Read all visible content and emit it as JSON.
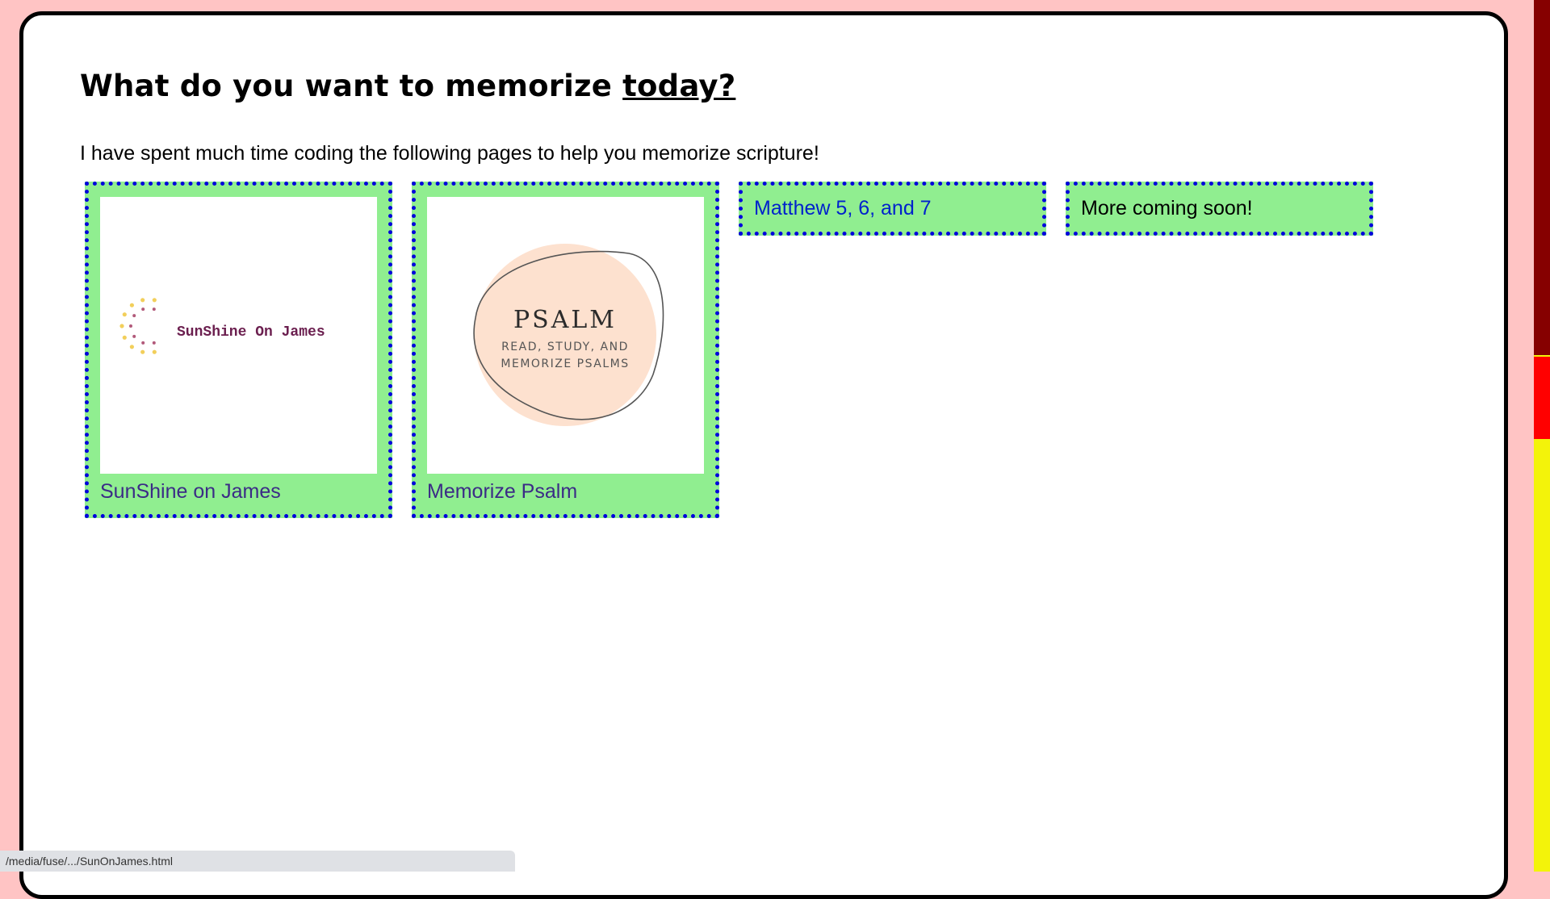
{
  "page": {
    "heading_prefix": "What do you want to memorize ",
    "heading_emphasis": "today?",
    "intro": "I have spent much time coding the following pages to help you memorize scripture!"
  },
  "tiles": [
    {
      "label": "SunShine on James",
      "image": {
        "logo_text": "SunShine On James",
        "icon": "sun-dots-icon"
      }
    },
    {
      "label": "Memorize Psalm",
      "image": {
        "title": "PSALM",
        "line1": "READ, STUDY, AND",
        "line2": "MEMORIZE PSALMS"
      }
    },
    {
      "label": "Matthew 5, 6, and 7"
    },
    {
      "label": "More coming soon!"
    }
  ],
  "status_bar": {
    "url": "/media/fuse/.../SunOnJames.html"
  },
  "colors": {
    "page_background": "#ffc4c4",
    "tile_background": "#90ee90",
    "tile_border": "#0000dd",
    "link_visited": "#3b2b86",
    "link": "#0022cc",
    "scroll_thumb": "#ff0000",
    "scroll_track_top": "#860000",
    "scroll_track_bottom": "#f3f30a"
  }
}
